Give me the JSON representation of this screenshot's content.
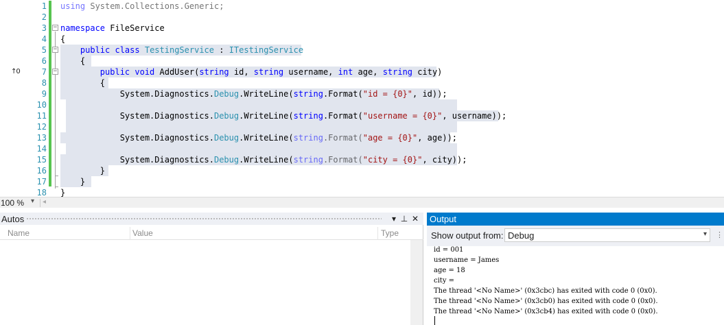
{
  "editor": {
    "line_numbers": [
      "1",
      "2",
      "3",
      "4",
      "5",
      "6",
      "7",
      "8",
      "9",
      "10",
      "11",
      "12",
      "13",
      "14",
      "15",
      "16",
      "17",
      "18"
    ],
    "bookmark_glyph": "↑0",
    "fold_marker": "−",
    "code": {
      "l1": {
        "kw": "using",
        "rest": " System.Collections.Generic;"
      },
      "l3": {
        "kw": "namespace",
        "rest": " FileService"
      },
      "l4": "{",
      "l5": {
        "indent": "    ",
        "kw": "public class",
        "sp": " ",
        "name": "TestingService",
        "colon": " : ",
        "iface": "ITestingService",
        "tail": " "
      },
      "l6": "    {",
      "l7": {
        "indent": "        ",
        "kw1": "public void",
        "mid": " AddUser(",
        "t1": "string",
        "p1": " id, ",
        "t2": "string",
        "p2": " username, ",
        "t3": "int",
        "p3": " age, ",
        "t4": "string",
        "p4": " city) "
      },
      "l8": "        {",
      "l9": {
        "indent": "            ",
        "a": "System.Diagnostics.",
        "dbg": "Debug",
        "b": ".WriteLine(",
        "t": "string",
        "c": ".Format(",
        "s": "\"id = {0}\"",
        "d": ", id));"
      },
      "l11": {
        "indent": "            ",
        "a": "System.Diagnostics.",
        "dbg": "Debug",
        "b": ".WriteLine(",
        "t": "string",
        "c": ".Format(",
        "s": "\"username = {0}\"",
        "d": ", username));"
      },
      "l13": {
        "indent": "            ",
        "a": "System.Diagnostics.",
        "dbg": "Debug",
        "b": ".WriteLine(",
        "t": "string",
        "c": ".Format(",
        "s": "\"age = {0}\"",
        "d": ", age));"
      },
      "l15": {
        "indent": "            ",
        "a": "System.Diagnostics.",
        "dbg": "Debug",
        "b": ".WriteLine(",
        "t": "string",
        "c": ".Format(",
        "s": "\"city = {0}\"",
        "d": ", city));"
      },
      "l16": "        }",
      "l17": "    }",
      "l18": "}"
    },
    "colors": {
      "keyword": "#0000ff",
      "type": "#2b91af",
      "string": "#a31515",
      "selection": "#e1e5ee",
      "change_bar": "#57c450"
    }
  },
  "zoom": {
    "value": "100 %",
    "caret": "▾",
    "scroll_left": "◂"
  },
  "autos": {
    "title": "Autos",
    "buttons": {
      "dropdown": "▾",
      "pin": "⊥",
      "close": "✕"
    },
    "columns": {
      "name": "Name",
      "value": "Value",
      "type": "Type"
    }
  },
  "output": {
    "title": "Output",
    "show_label": "Show output from:",
    "source": "Debug",
    "source_arrow": "▾",
    "toolbar_icon": "⋮",
    "text": "id = 001\nusername = James\nage = 18\ncity =\nThe thread '<No Name>' (0x3cbc) has exited with code 0 (0x0).\nThe thread '<No Name>' (0x3cb0) has exited with code 0 (0x0).\nThe thread '<No Name>' (0x3cb4) has exited with code 0 (0x0).",
    "accent": "#007acc"
  }
}
